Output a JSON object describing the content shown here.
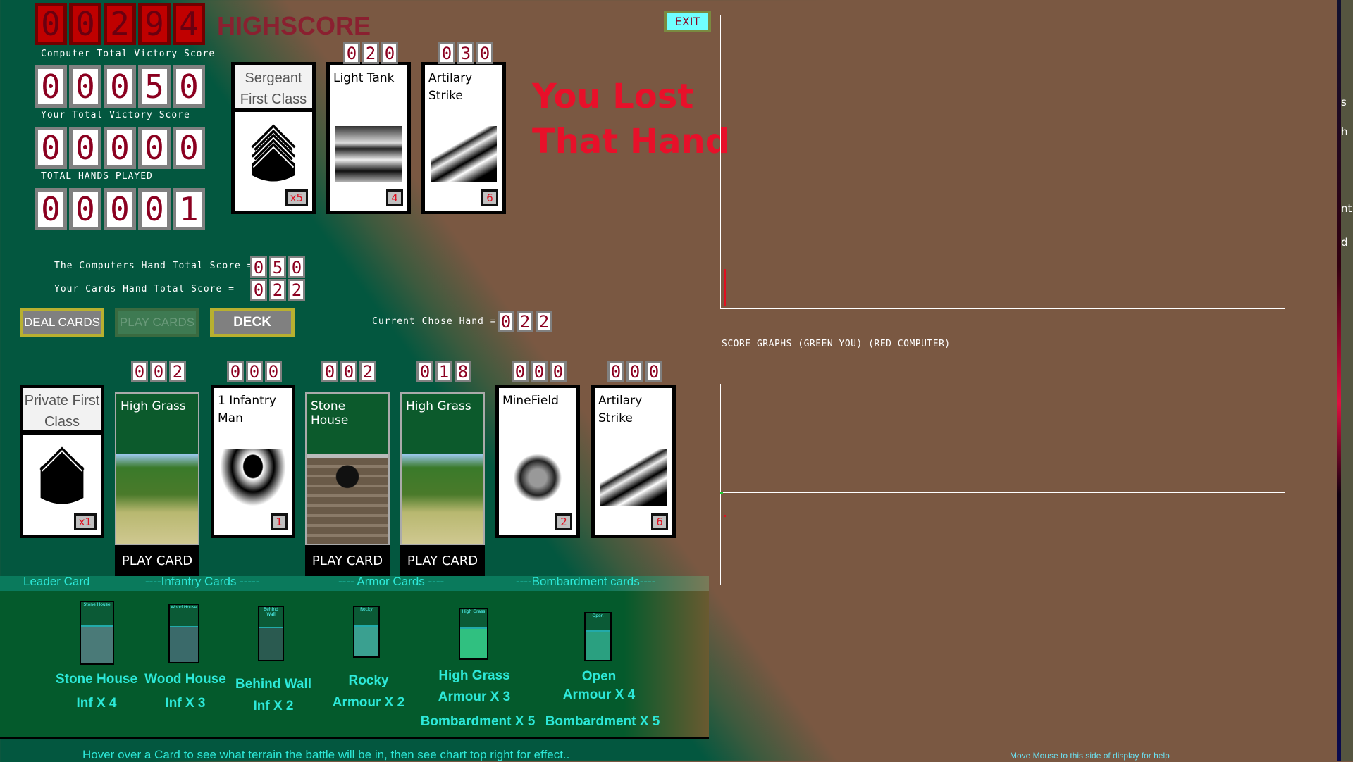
{
  "highscore": {
    "digits": "00294",
    "label": "HIGHSCORE"
  },
  "scores": [
    {
      "label": "Computer Total Victory Score",
      "digits": "00050"
    },
    {
      "label": "Your Total Victory Score",
      "digits": "00000"
    },
    {
      "label": "TOTAL HANDS PLAYED",
      "digits": "00001"
    }
  ],
  "exit_label": "EXIT",
  "result_text": [
    "You Lost",
    "That Hand"
  ],
  "computer_hand": {
    "label": "The Computers Hand Total Score =",
    "digits": "050"
  },
  "your_hand": {
    "label": "Your Cards Hand Total Score =",
    "digits": "022"
  },
  "current_hand": {
    "label": "Current Chose Hand =",
    "digits": "022"
  },
  "buttons": {
    "deal": "DEAL CARDS",
    "play": "PLAY CARDS",
    "deck": "DECK"
  },
  "computer_cards": [
    {
      "type": "leader",
      "title": "Sergeant First Class",
      "badge": "x5",
      "icon": "sergeant-first-class-chevron"
    },
    {
      "type": "unit",
      "title": "Light Tank",
      "badge": "4",
      "score": "020",
      "icon": "tank-photo"
    },
    {
      "type": "unit",
      "title": "Artilary Strike",
      "badge": "6",
      "score": "030",
      "icon": "artillery-photo"
    }
  ],
  "player_cards": [
    {
      "type": "leader",
      "title": "Private First Class",
      "badge": "x1",
      "icon": "private-first-class-chevron"
    },
    {
      "type": "terrain",
      "title": "High Grass",
      "score": "002",
      "play": "PLAY CARD",
      "img": "grass"
    },
    {
      "type": "unit",
      "title": "1 Infantry Man",
      "badge": "1",
      "score": "000",
      "icon": "soldier-silhouette"
    },
    {
      "type": "terrain",
      "title": "Stone House",
      "score": "002",
      "play": "PLAY CARD",
      "img": "stone"
    },
    {
      "type": "terrain",
      "title": "High Grass",
      "score": "018",
      "play": "PLAY CARD",
      "img": "grass"
    },
    {
      "type": "unit",
      "title": "MineField",
      "badge": "2",
      "score": "000",
      "icon": "landmine-photo"
    },
    {
      "type": "unit",
      "title": "Artilary Strike",
      "badge": "6",
      "score": "000",
      "icon": "artillery-photo"
    }
  ],
  "legend_headers": [
    "Leader Card",
    "----Infantry Cards -----",
    "---- Armor Cards ----",
    "----Bombardment cards----"
  ],
  "terrain_legend": [
    {
      "mini": "Stone House",
      "name": "Stone House",
      "effects": [
        "Inf X 4"
      ]
    },
    {
      "mini": "Wood House",
      "name": "Wood House",
      "effects": [
        "Inf X 3"
      ]
    },
    {
      "mini": "Behind Wall",
      "name": "Behind Wall",
      "effects": [
        "Inf X 2"
      ]
    },
    {
      "mini": "Rocky",
      "name": "Rocky",
      "effects": [
        "Armour X 2"
      ]
    },
    {
      "mini": "High Grass",
      "name": "High Grass",
      "effects": [
        "Armour X 3",
        "Bombardment X 5"
      ]
    },
    {
      "mini": "Open",
      "name": "Open",
      "effects": [
        "Armour X 4",
        "Bombardment X 5"
      ]
    }
  ],
  "graph": {
    "title": "SCORE GRAPHS (GREEN YOU) (RED COMPUTER)",
    "colors": {
      "you": "#22cc33",
      "computer": "#e01020"
    }
  },
  "hover_hint": "Hover over a Card to see what terrain the battle will be in, then see chart top right for effect..",
  "help_hint": "Move Mouse to this side of display for help",
  "side_panel_fragments": [
    "s",
    "h",
    "nt",
    "d"
  ]
}
